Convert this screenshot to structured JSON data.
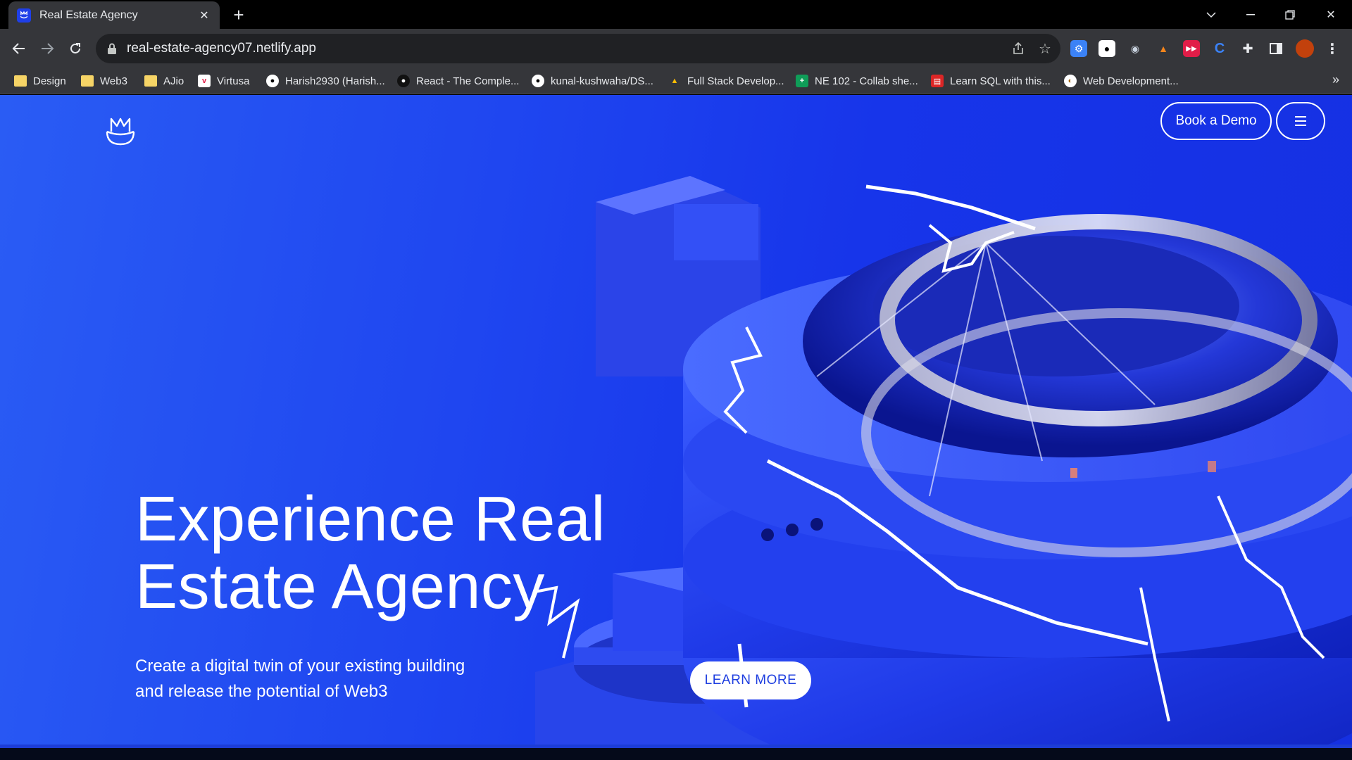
{
  "browser": {
    "tab": {
      "title": "Real Estate Agency"
    },
    "url": "real-estate-agency07.netlify.app",
    "bookmarks": [
      {
        "label": "Design",
        "icon": "folder-icon"
      },
      {
        "label": "Web3",
        "icon": "folder-icon"
      },
      {
        "label": "AJio",
        "icon": "folder-icon"
      },
      {
        "label": "Virtusa",
        "icon": "virtusa-icon"
      },
      {
        "label": "Harish2930 (Harish...",
        "icon": "github-icon"
      },
      {
        "label": "React - The Comple...",
        "icon": "react-icon"
      },
      {
        "label": "kunal-kushwaha/DS...",
        "icon": "github-icon"
      },
      {
        "label": "Full Stack Develop...",
        "icon": "drive-icon"
      },
      {
        "label": "NE 102 - Collab she...",
        "icon": "sheets-icon"
      },
      {
        "label": "Learn SQL with this...",
        "icon": "sql-icon"
      },
      {
        "label": "Web Development...",
        "icon": "web-dev-icon"
      }
    ]
  },
  "page": {
    "nav": {
      "demo_label": "Book a Demo"
    },
    "hero": {
      "title_line1": "Experience Real",
      "title_line2": "Estate Agency",
      "subtitle_line1": "Create a digital twin of your existing building",
      "subtitle_line2": "and release the potential of Web3",
      "cta_label": "LEARN MORE"
    },
    "colors": {
      "background": "#1f46f0",
      "button_text": "#1f3fe0"
    }
  }
}
